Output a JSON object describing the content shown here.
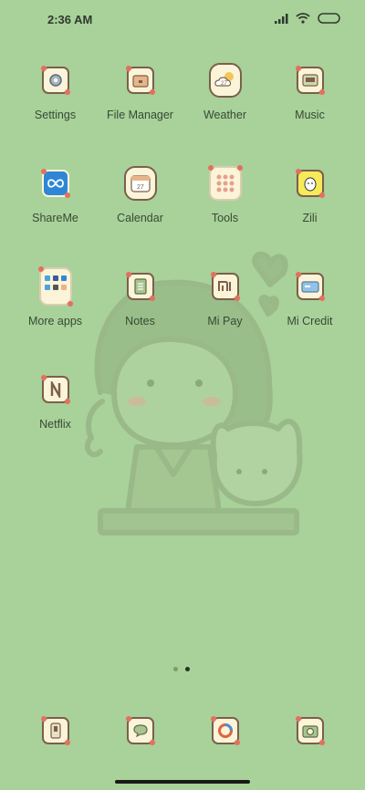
{
  "status_bar": {
    "time": "2:36 AM"
  },
  "apps": [
    {
      "name": "settings",
      "label": "Settings",
      "icon": "gear-icon"
    },
    {
      "name": "file-manager",
      "label": "File Manager",
      "icon": "folder-icon"
    },
    {
      "name": "weather",
      "label": "Weather",
      "icon": "cloud-sun-icon",
      "badge_text": "27"
    },
    {
      "name": "music",
      "label": "Music",
      "icon": "music-player-icon"
    },
    {
      "name": "shareme",
      "label": "ShareMe",
      "icon": "infinity-icon"
    },
    {
      "name": "calendar",
      "label": "Calendar",
      "icon": "calendar-icon",
      "badge_text": "27"
    },
    {
      "name": "tools",
      "label": "Tools",
      "icon": "tools-folder-icon"
    },
    {
      "name": "zili",
      "label": "Zili",
      "icon": "zili-face-icon"
    },
    {
      "name": "more-apps",
      "label": "More apps",
      "icon": "apps-folder-icon"
    },
    {
      "name": "notes",
      "label": "Notes",
      "icon": "notebook-icon"
    },
    {
      "name": "mi-pay",
      "label": "Mi Pay",
      "icon": "mi-logo-icon"
    },
    {
      "name": "mi-credit",
      "label": "Mi Credit",
      "icon": "credit-card-icon"
    },
    {
      "name": "netflix",
      "label": "Netflix",
      "icon": "netflix-n-icon"
    }
  ],
  "dock": [
    {
      "name": "phone",
      "icon": "phone-icon"
    },
    {
      "name": "messages",
      "icon": "chat-bubble-icon"
    },
    {
      "name": "browser",
      "icon": "browser-ring-icon"
    },
    {
      "name": "camera",
      "icon": "camera-icon"
    }
  ],
  "pager": {
    "pages": 2,
    "active": 2
  },
  "colors": {
    "background": "#a9d19a",
    "tile": "#fbf4d8",
    "tile_border": "#7b5f4b",
    "accent_dot": "#e56f5e",
    "label": "#374a34"
  }
}
